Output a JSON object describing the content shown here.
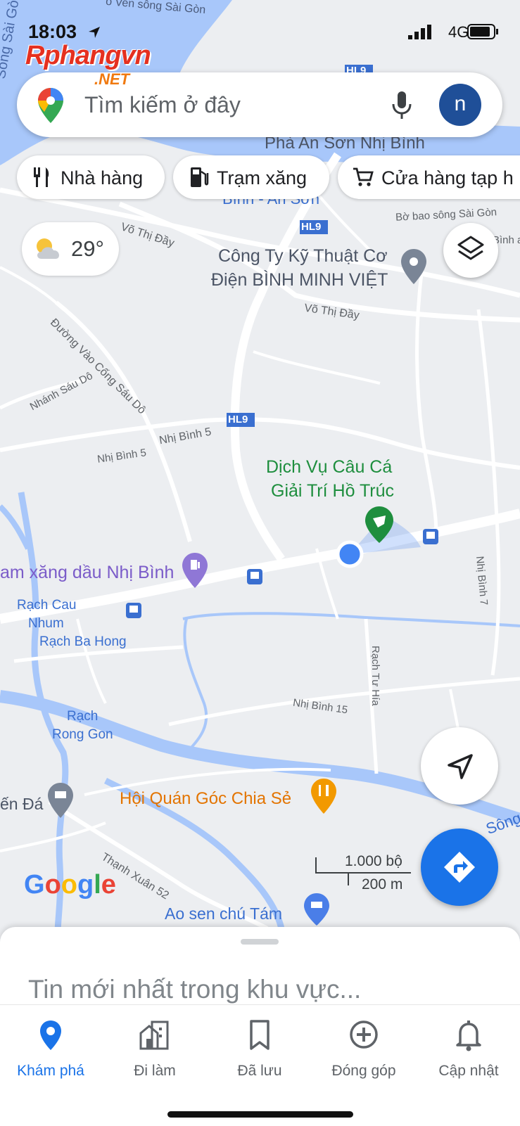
{
  "status_bar": {
    "time": "18:03",
    "network": "4G"
  },
  "watermark": {
    "line1": "Rphangvn",
    "line2": ".NET"
  },
  "search": {
    "placeholder": "Tìm kiếm ở đây",
    "avatar_letter": "n",
    "mic_icon": "mic-icon",
    "logo_icon": "maps-pin-logo-icon"
  },
  "chips": [
    {
      "label": "Nhà hàng",
      "icon": "fork-knife-icon"
    },
    {
      "label": "Trạm xăng",
      "icon": "gas-pump-icon"
    },
    {
      "label": "Cửa hàng tạp h",
      "icon": "cart-icon"
    }
  ],
  "weather": {
    "temperature": "29°",
    "icon": "partly-cloudy-icon"
  },
  "map": {
    "colors": {
      "land": "#eceef1",
      "road": "#ffffff",
      "water": "#a8c7fa",
      "water_dark": "#5c8ae6",
      "poi_green": "#1e8e3e",
      "poi_orange": "#e37400",
      "poi_purple": "#7b5cc9",
      "user_location": "#4285f4"
    },
    "labels": {
      "river_top": "o Ven sông Sài Gòn",
      "river_left": "Sông Sài Gòn",
      "ferry": "Phà An Sơn Nhị Bình",
      "ferry_sub": "Bình - An Sơn",
      "embankment": "Bờ bao sông Sài Gòn",
      "hl9_a": "HL9",
      "hl9_b": "HL9",
      "hl9_c": "HL9",
      "vo_thi_day_1": "Võ Thị Đầy",
      "vo_thi_day_2": "Võ Thị Đầy",
      "binh_a": "Bình a",
      "company_1": "Công Ty Kỹ Thuật Cơ",
      "company_2": "Điện BÌNH MINH VIỆT",
      "duong_vao": "Đường Vào Cống Sáu Dô",
      "nhanh_sau_do": "Nhánh Sáu Dô",
      "nhi_binh_5a": "Nhị Bình 5",
      "nhi_binh_5b": "Nhị Bình 5",
      "fishing_1": "Dịch Vụ Câu Cá",
      "fishing_2": "Giải Trí Hồ Trúc",
      "gas_station": "am xăng dầu Nhị Bình",
      "nhi_binh_7": "Nhị Bình 7",
      "rach_cau_1": "Rạch Cau",
      "rach_cau_2": "Nhum",
      "rach_ba_hong": "Rạch Ba Hong",
      "rach_tu_hia": "Rạch Tư Hía",
      "nhi_binh_15": "Nhị Bình 15",
      "rach_rong_1": "Rạch",
      "rach_rong_2": "Rong Gon",
      "en_da": "ến Đá",
      "hoi_quan": "Hội Quán Góc Chia Sẻ",
      "song": "Sông",
      "thanh_xuan": "Thạnh Xuân 52",
      "ao_sen": "Ao sen chú Tám"
    }
  },
  "scale": {
    "imperial": "1.000 bộ",
    "metric": "200 m"
  },
  "google_logo": "Google",
  "buttons": {
    "layers_icon": "layers-icon",
    "locate_icon": "navigation-arrow-icon",
    "directions_icon": "directions-icon"
  },
  "sheet": {
    "title": "Tin mới nhất trong khu vực..."
  },
  "bottom_nav": [
    {
      "label": "Khám phá",
      "icon": "explore-pin-icon",
      "active": true
    },
    {
      "label": "Đi làm",
      "icon": "commute-building-icon",
      "active": false
    },
    {
      "label": "Đã lưu",
      "icon": "bookmark-icon",
      "active": false
    },
    {
      "label": "Đóng góp",
      "icon": "add-circle-icon",
      "active": false
    },
    {
      "label": "Cập nhật",
      "icon": "bell-icon",
      "active": false
    }
  ],
  "accent_color": "#1a73e8"
}
